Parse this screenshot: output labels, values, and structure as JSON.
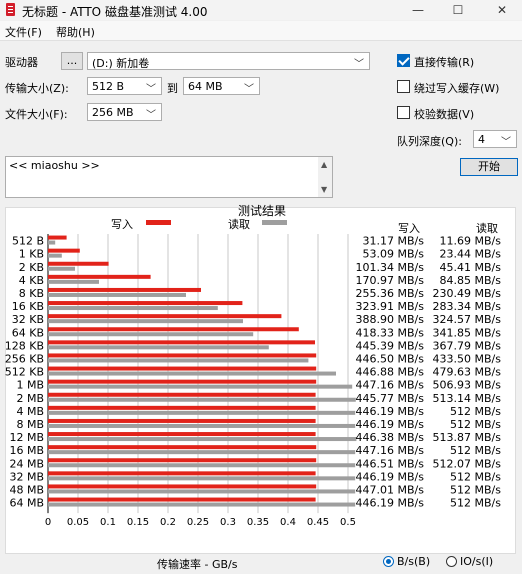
{
  "window": {
    "title": "无标题 - ATTO 磁盘基准测试 4.00",
    "minimize_icon": "minimize-icon",
    "maximize_icon": "maximize-icon",
    "close_icon": "close-icon"
  },
  "menu": {
    "file": "文件(F)",
    "help": "帮助(H)"
  },
  "controls": {
    "drive_label": "驱动器",
    "browse_label": "...",
    "drive_value": "(D:) 新加卷",
    "transfer_label": "传输大小(Z):",
    "transfer_from": "512 B",
    "to_label": "到",
    "transfer_to": "64 MB",
    "file_size_label": "文件大小(F):",
    "file_size": "256 MB",
    "direct_io": "直接传输(R)",
    "bypass_write_cache": "绕过写入缓存(W)",
    "verify_data": "校验数据(V)",
    "queue_depth_label": "队列深度(Q):",
    "queue_depth": "4",
    "start_button": "开始",
    "notes": "<< miaoshu >>"
  },
  "checkbox_state": {
    "direct_io": true,
    "bypass_write_cache": false,
    "verify_data": false
  },
  "results": {
    "test_results_title": "测试结果",
    "write_header": "写入",
    "read_header": "读取",
    "legend_write": "写入",
    "legend_read": "读取",
    "xaxis_label": "传输速率 - GB/s",
    "unit_bytes": "B/s(B)",
    "unit_io": "IO/s(I)"
  },
  "colors": {
    "write": "#e2231a",
    "read": "#9e9e9e",
    "accent": "#0067c0"
  },
  "chart_data": {
    "type": "bar",
    "orientation": "horizontal",
    "xlabel": "传输速率 - GB/s",
    "xlim": [
      0,
      0.5
    ],
    "xticks": [
      "0",
      "0.05",
      "0.1",
      "0.15",
      "0.2",
      "0.25",
      "0.3",
      "0.35",
      "0.4",
      "0.45",
      "0.5"
    ],
    "categories": [
      "512 B",
      "1 KB",
      "2 KB",
      "4 KB",
      "8 KB",
      "16 KB",
      "32 KB",
      "64 KB",
      "128 KB",
      "256 KB",
      "512 KB",
      "1 MB",
      "2 MB",
      "4 MB",
      "8 MB",
      "12 MB",
      "16 MB",
      "24 MB",
      "32 MB",
      "48 MB",
      "64 MB"
    ],
    "series": [
      {
        "name": "写入",
        "values": [
          0.031,
          0.053,
          0.101,
          0.171,
          0.255,
          0.324,
          0.389,
          0.418,
          0.445,
          0.447,
          0.447,
          0.447,
          0.446,
          0.446,
          0.446,
          0.446,
          0.447,
          0.447,
          0.446,
          0.447,
          0.446
        ],
        "labels": [
          "31.17 MB/s",
          "53.09 MB/s",
          "101.34 MB/s",
          "170.97 MB/s",
          "255.36 MB/s",
          "323.91 MB/s",
          "388.90 MB/s",
          "418.33 MB/s",
          "445.39 MB/s",
          "446.50 MB/s",
          "446.88 MB/s",
          "447.16 MB/s",
          "445.77 MB/s",
          "446.19 MB/s",
          "446.19 MB/s",
          "446.38 MB/s",
          "447.16 MB/s",
          "446.51 MB/s",
          "446.19 MB/s",
          "447.01 MB/s",
          "446.19 MB/s"
        ]
      },
      {
        "name": "读取",
        "values": [
          0.012,
          0.023,
          0.045,
          0.085,
          0.23,
          0.283,
          0.325,
          0.342,
          0.368,
          0.434,
          0.48,
          0.507,
          0.513,
          0.512,
          0.512,
          0.514,
          0.512,
          0.512,
          0.512,
          0.512,
          0.512
        ],
        "labels": [
          "11.69 MB/s",
          "23.44 MB/s",
          "45.41 MB/s",
          "84.85 MB/s",
          "230.49 MB/s",
          "283.34 MB/s",
          "324.57 MB/s",
          "341.85 MB/s",
          "367.79 MB/s",
          "433.50 MB/s",
          "479.63 MB/s",
          "506.93 MB/s",
          "513.14 MB/s",
          "512 MB/s",
          "512 MB/s",
          "513.87 MB/s",
          "512 MB/s",
          "512.07 MB/s",
          "512 MB/s",
          "512 MB/s",
          "512 MB/s"
        ]
      }
    ]
  }
}
